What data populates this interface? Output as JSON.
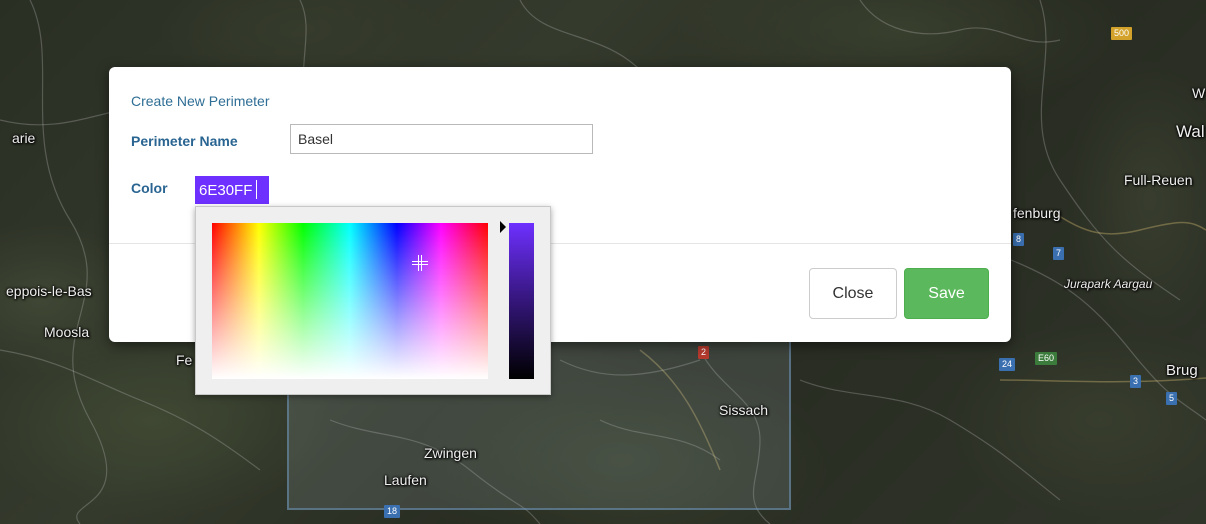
{
  "map": {
    "labels": {
      "arie": "arie",
      "poppois": "eppois-le-Bas",
      "mooslar": "Moosla",
      "fe": "Fe",
      "wal": "Wal",
      "w": "W",
      "full_reuen": "Full-Reuen",
      "fenburg": "fenburg",
      "jurapark": "Jurapark Aargau",
      "brug": "Brug",
      "sissach": "Sissach",
      "zwingen": "Zwingen",
      "laufen": "Laufen"
    },
    "shields": {
      "s500": "500",
      "s7": "7",
      "s24": "24",
      "e60": "E60",
      "s3": "3",
      "s5": "5",
      "s2": "2",
      "s18": "18",
      "s8": "8"
    }
  },
  "modal": {
    "title": "Create New Perimeter",
    "name_label": "Perimeter Name",
    "name_value": "Basel",
    "color_label": "Color",
    "color_value": "6E30FF",
    "close_label": "Close",
    "save_label": "Save"
  },
  "picker": {
    "selected_color": "#6e30ff"
  }
}
